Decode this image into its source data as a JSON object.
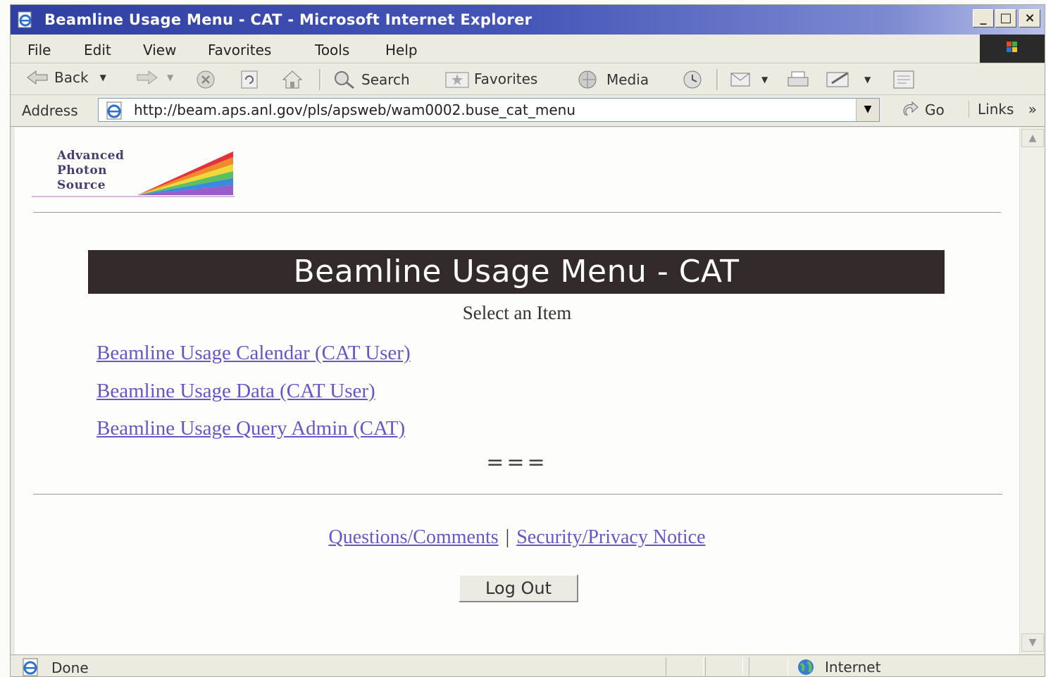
{
  "window": {
    "title": "Beamline Usage Menu - CAT - Microsoft Internet Explorer",
    "controls": {
      "minimize": "_",
      "maximize": "□",
      "close": "×"
    }
  },
  "menubar": [
    "File",
    "Edit",
    "View",
    "Favorites",
    "Tools",
    "Help"
  ],
  "toolbar": {
    "back": "Back",
    "search": "Search",
    "favorites": "Favorites",
    "media": "Media"
  },
  "address": {
    "label": "Address",
    "url": "http://beam.aps.anl.gov/pls/apsweb/wam0002.buse_cat_menu",
    "go": "Go",
    "links": "Links",
    "links_chevron": "»"
  },
  "page": {
    "logo_lines": [
      "Advanced",
      "Photon",
      "Source"
    ],
    "heading": "Beamline Usage Menu - CAT",
    "subtitle": "Select an Item",
    "menu_links": [
      "Beamline Usage Calendar (CAT User)",
      "Beamline Usage Data (CAT User)",
      "Beamline Usage Query Admin (CAT)"
    ],
    "separator": "===",
    "footer": {
      "questions": "Questions/Comments",
      "divider": "|",
      "privacy": "Security/Privacy Notice"
    },
    "logout": "Log Out"
  },
  "status": {
    "text": "Done",
    "zone": "Internet"
  },
  "colors": {
    "titlebar": "#2f3fa2",
    "link": "#6a55c8",
    "heading_bg": "#332b2b"
  }
}
